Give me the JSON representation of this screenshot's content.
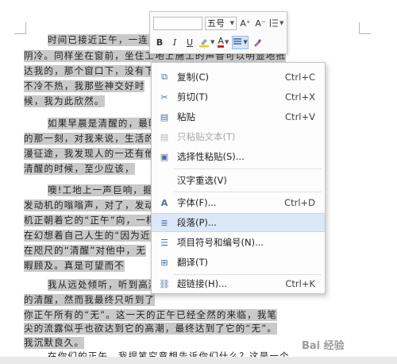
{
  "document": {
    "lines": [
      "时间已接近正午，一连几天的",
      "阴冷。同样坐在窗前，坐住工地上施工的声音可以明显地抵",
      "达我的，那个窗口下，没有下天，天气",
      "不冷不热，我那些神交好时",
      "候，我为此欣然。",
      "如果早晨是清醒的，最旺盛",
      "的那一刻，对我来说，生活的漫",
      "漫征途，我发现人的一还有他最",
      "清醒的时候，至少应该，",
      "噢!工地上一声巨响，掘续响起",
      "发动机的嗡嗡声，对了，发动",
      "机正朝着它的“正午”向，一样，",
      "在幻想着自己人生的“因为近",
      "在咫尺的“清醒”对他中，无",
      "暇顾及。真是可望而不",
      "我从远处倾听，听到高潮",
      "的清醒，然而我最终只听到了",
      "你正午所有的“无”。这一天的正午已经全然的来临，我笔",
      "尖的流露似乎也欲达到它的高潮，最终达到了它的“无”。",
      "我沉默良久。",
      "在你们的正午，我提笔究竟想告诉你们什么？这是一个"
    ]
  },
  "mini_toolbar": {
    "font_name": "",
    "font_size": "五号",
    "grow_font": "A⁺",
    "shrink_font": "A⁻",
    "line_spacing_icon": "line-spacing-icon",
    "bold": "B",
    "italic": "I",
    "underline": "U",
    "highlight_icon": "highlighter-icon",
    "font_color": "A",
    "align_icon": "align-icon",
    "format_painter_icon": "format-painter-icon",
    "colors": {
      "highlight": "#e8d21e",
      "font_color": "#d9261c",
      "selected_bg": "#d6e4f5"
    }
  },
  "context_menu": {
    "items": [
      {
        "icon": "copy-icon",
        "label": "复制(C)",
        "shortcut": "Ctrl+C",
        "disabled": false
      },
      {
        "icon": "cut-icon",
        "label": "剪切(T)",
        "shortcut": "Ctrl+X",
        "disabled": false
      },
      {
        "icon": "paste-icon",
        "label": "粘贴",
        "shortcut": "Ctrl+V",
        "disabled": false
      },
      {
        "icon": "paste-text-icon",
        "label": "只粘贴文本(T)",
        "shortcut": "",
        "disabled": true
      },
      {
        "icon": "paste-special-icon",
        "label": "选择性粘贴(S)...",
        "shortcut": "",
        "disabled": false
      },
      {
        "icon": "",
        "label": "汉字重选(V)",
        "shortcut": "",
        "disabled": false
      },
      {
        "icon": "font-icon",
        "label": "字体(F)...",
        "shortcut": "Ctrl+D",
        "disabled": false
      },
      {
        "icon": "paragraph-icon",
        "label": "段落(P)...",
        "shortcut": "",
        "disabled": false,
        "hovered": true
      },
      {
        "icon": "bullets-numbering-icon",
        "label": "项目符号和编号(N)...",
        "shortcut": "",
        "disabled": false
      },
      {
        "icon": "translate-icon",
        "label": "翻译(T)",
        "shortcut": "",
        "disabled": false
      },
      {
        "icon": "hyperlink-icon",
        "label": "超链接(H)...",
        "shortcut": "Ctrl+K",
        "disabled": false
      }
    ],
    "hover_color": "#dbe8f8"
  },
  "watermark": "Bai 经验"
}
